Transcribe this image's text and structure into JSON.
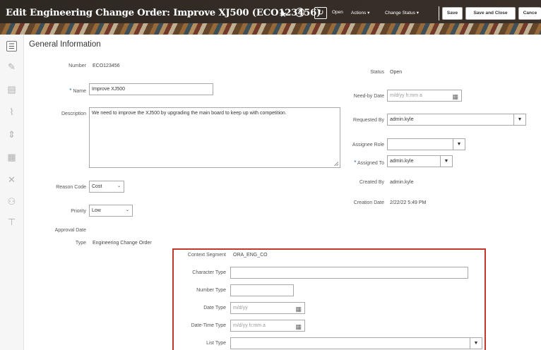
{
  "header": {
    "title": "Edit Engineering Change Order: Improve XJ500 (ECO123456)",
    "star": "★",
    "help": "?",
    "refresh": "↻",
    "open_label": "Open",
    "actions_label": "Actions ▾",
    "change_status_label": "Change Status ▾",
    "save_label": "Save",
    "save_close_label": "Save and Close",
    "cancel_label": "Cance"
  },
  "rail": {
    "icons": [
      "list-icon",
      "edit-icon",
      "checklist-icon",
      "attachment-icon",
      "split-icon",
      "structure-icon",
      "network-icon",
      "people-icon",
      "hierarchy-icon"
    ]
  },
  "section_title": "General Information",
  "form": {
    "number_label": "Number",
    "number_value": "ECO123456",
    "name_label": "Name",
    "name_value": "Improve XJ500",
    "description_label": "Description",
    "description_value": "We need to improve the XJ500 by upgrading the main board to keep up with competition.",
    "reason_code_label": "Reason Code",
    "reason_code_value": "Cost",
    "priority_label": "Priority",
    "priority_value": "Low",
    "approval_date_label": "Approval Date",
    "type_label": "Type",
    "type_value": "Engineering Change Order",
    "status_label": "Status",
    "status_value": "Open",
    "need_by_label": "Need-by Date",
    "need_by_placeholder": "m/d/yy h:mm a",
    "requested_by_label": "Requested By",
    "requested_by_value": "admin.kyle",
    "assignee_role_label": "Assignee Role",
    "assignee_role_value": "",
    "assigned_to_label": "Assigned To",
    "assigned_to_value": "admin.kyle",
    "created_by_label": "Created By",
    "created_by_value": "admin.kyle",
    "creation_date_label": "Creation Date",
    "creation_date_value": "2/22/22 5:49 PM"
  },
  "context": {
    "segment_label": "Context Segment",
    "segment_value": "ORA_ENG_CO",
    "character_type_label": "Character Type",
    "number_type_label": "Number Type",
    "date_type_label": "Date Type",
    "date_type_placeholder": "m/d/yy",
    "datetime_type_label": "Date-Time Type",
    "datetime_type_placeholder": "m/d/yy h:mm a",
    "list_type_label": "List Type"
  },
  "icons": {
    "select_arrow": "⌄",
    "dropdown_arrow": "▼",
    "calendar": "📅",
    "required": "*"
  },
  "colors": {
    "header_bg": "#2e2822",
    "highlight_border": "#c0392b",
    "required": "#2b6cb0"
  }
}
